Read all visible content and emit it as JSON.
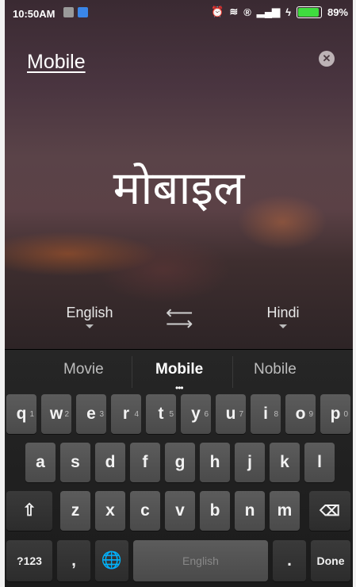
{
  "status_bar": {
    "time": "10:50AM",
    "battery": "89%"
  },
  "source_word": "Mobile",
  "translation": "मोबाइल",
  "source_language": "English",
  "target_language": "Hindi",
  "swap_icon": "swap-arrows-icon",
  "suggestions": [
    "Movie",
    "Mobile",
    "Nobile"
  ],
  "keyboard": {
    "row1": [
      "q",
      "w",
      "e",
      "r",
      "t",
      "y",
      "u",
      "i",
      "o",
      "p"
    ],
    "row1_hints": [
      "1",
      "2",
      "3",
      "4",
      "5",
      "6",
      "7",
      "8",
      "9",
      "0"
    ],
    "row2": [
      "a",
      "s",
      "d",
      "f",
      "g",
      "h",
      "j",
      "k",
      "l"
    ],
    "row3": [
      "z",
      "x",
      "c",
      "v",
      "b",
      "n",
      "m"
    ],
    "symbols_label": "?123",
    "comma": ",",
    "space_label": "English",
    "period": ".",
    "done_label": "Done"
  },
  "colors": {
    "battery": "#3fdc3f",
    "keyboard_bg": "#1f1f1f",
    "key": "#525252"
  }
}
